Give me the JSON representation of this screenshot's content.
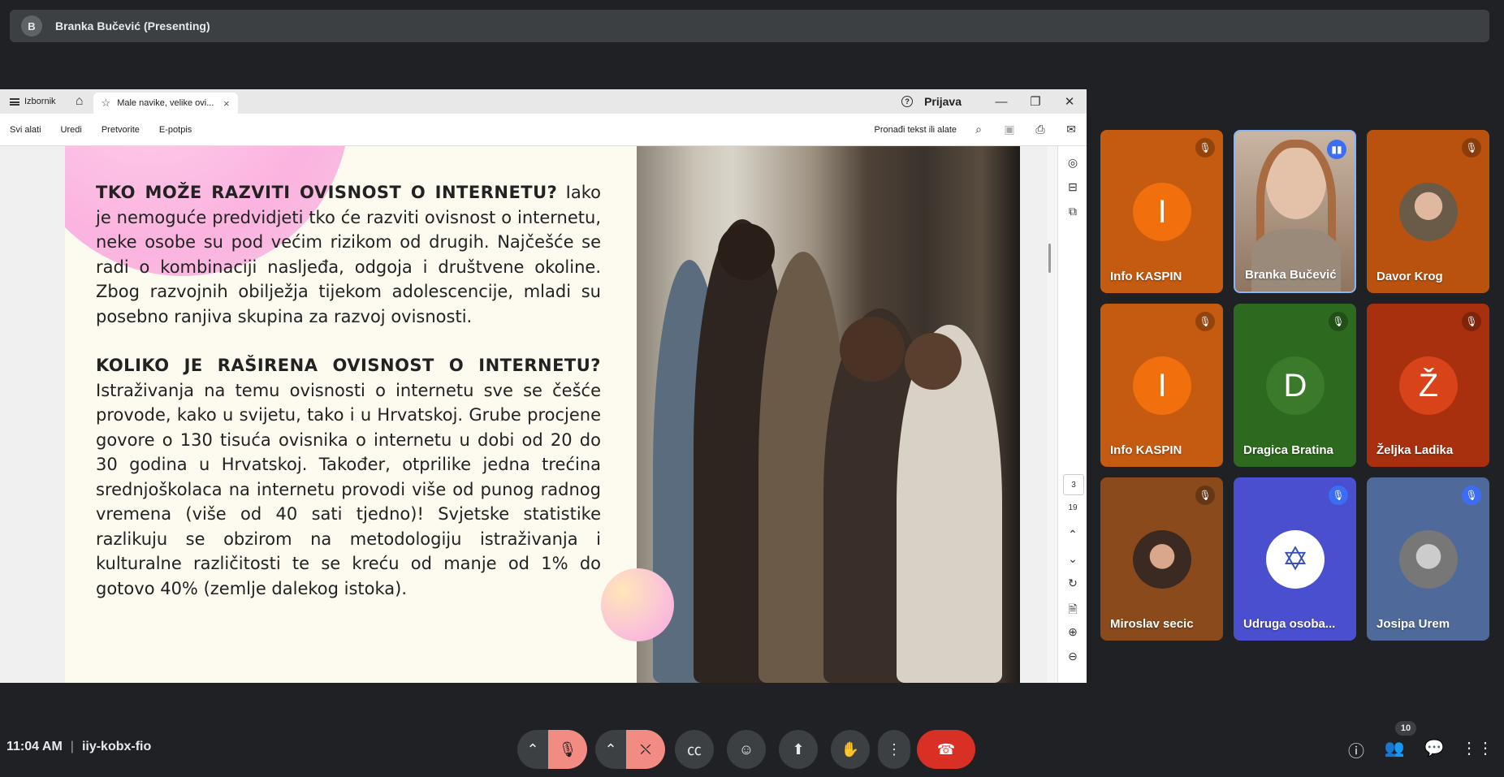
{
  "topbar": {
    "avatar_letter": "B",
    "presenter": "Branka Bučević (Presenting)"
  },
  "pdf": {
    "menu_label": "Izbornik",
    "tab_title": "Male navike, velike ovi...",
    "login": "Prijava",
    "help_icon": "?",
    "toolbar": {
      "all_tools": "Svi alati",
      "edit": "Uredi",
      "convert": "Pretvorite",
      "esign": "E-potpis",
      "find": "Pronađi tekst ili alate"
    },
    "page_current": "3",
    "page_total": "19",
    "content": {
      "heading1": "TKO MOŽE RAZVITI OVISNOST O INTERNETU?",
      "body1": "Iako je nemoguće predvidjeti tko će razviti ovisnost o internetu, neke osobe su pod većim rizikom od drugih. Najčešće se radi o kombinaciji nasljeđa, odgoja i društvene okoline. Zbog razvojnih obilježja tijekom adolescencije, mladi su posebno ranjiva skupina za razvoj ovisnosti.",
      "heading2": "KOLIKO JE RAŠIRENA OVISNOST O INTERNETU?",
      "body2": "Istraživanja na temu ovisnosti o internetu sve se češće provode, kako u svijetu, tako i u Hrvatskoj. Grube procjene govore o 130 tisuća ovisnika o internetu u dobi od 20 do 30 godina u Hrvatskoj. Također, otprilike jedna trećina srednjoškolaca na internetu provodi više od punog radnog vremena (više od 40 sati tjedno)! Svjetske statistike razlikuju se obzirom na metodologiju istraživanja i kulturalne različitosti te se kreću od manje od 1% do gotovo 40% (zemlje dalekog istoka)."
    }
  },
  "participants": [
    {
      "name": "Info KASPIN",
      "initial": "I",
      "bg": "#c55a11",
      "avatar_bg": "#f26f0d",
      "mic": "muted"
    },
    {
      "name": "Branka Bučević",
      "initial": "",
      "bg": "#b08a6f",
      "mic": "speaking"
    },
    {
      "name": "Davor Krog",
      "initial": "",
      "bg": "#b8520e",
      "mic": "muted"
    },
    {
      "name": "Info KASPIN",
      "initial": "I",
      "bg": "#c55a11",
      "avatar_bg": "#f26f0d",
      "mic": "muted"
    },
    {
      "name": "Dragica Bratina",
      "initial": "D",
      "bg": "#2d6a1f",
      "avatar_bg": "#3a7a2a",
      "mic": "muted"
    },
    {
      "name": "Željka Ladika",
      "initial": "Ž",
      "bg": "#a8300f",
      "avatar_bg": "#d8431a",
      "mic": "muted"
    },
    {
      "name": "Miroslav secic",
      "initial": "",
      "bg": "#8a4a1c",
      "mic": "muted"
    },
    {
      "name": "Udruga osoba...",
      "initial": "",
      "bg": "#4a4fcf",
      "mic": "muted"
    },
    {
      "name": "Josipa Urem",
      "initial": "",
      "bg": "#4f6a9a",
      "mic": "muted"
    }
  ],
  "bottom": {
    "time": "11:04 AM",
    "meeting_code": "iiy-kobx-fio",
    "people_count": "10"
  }
}
